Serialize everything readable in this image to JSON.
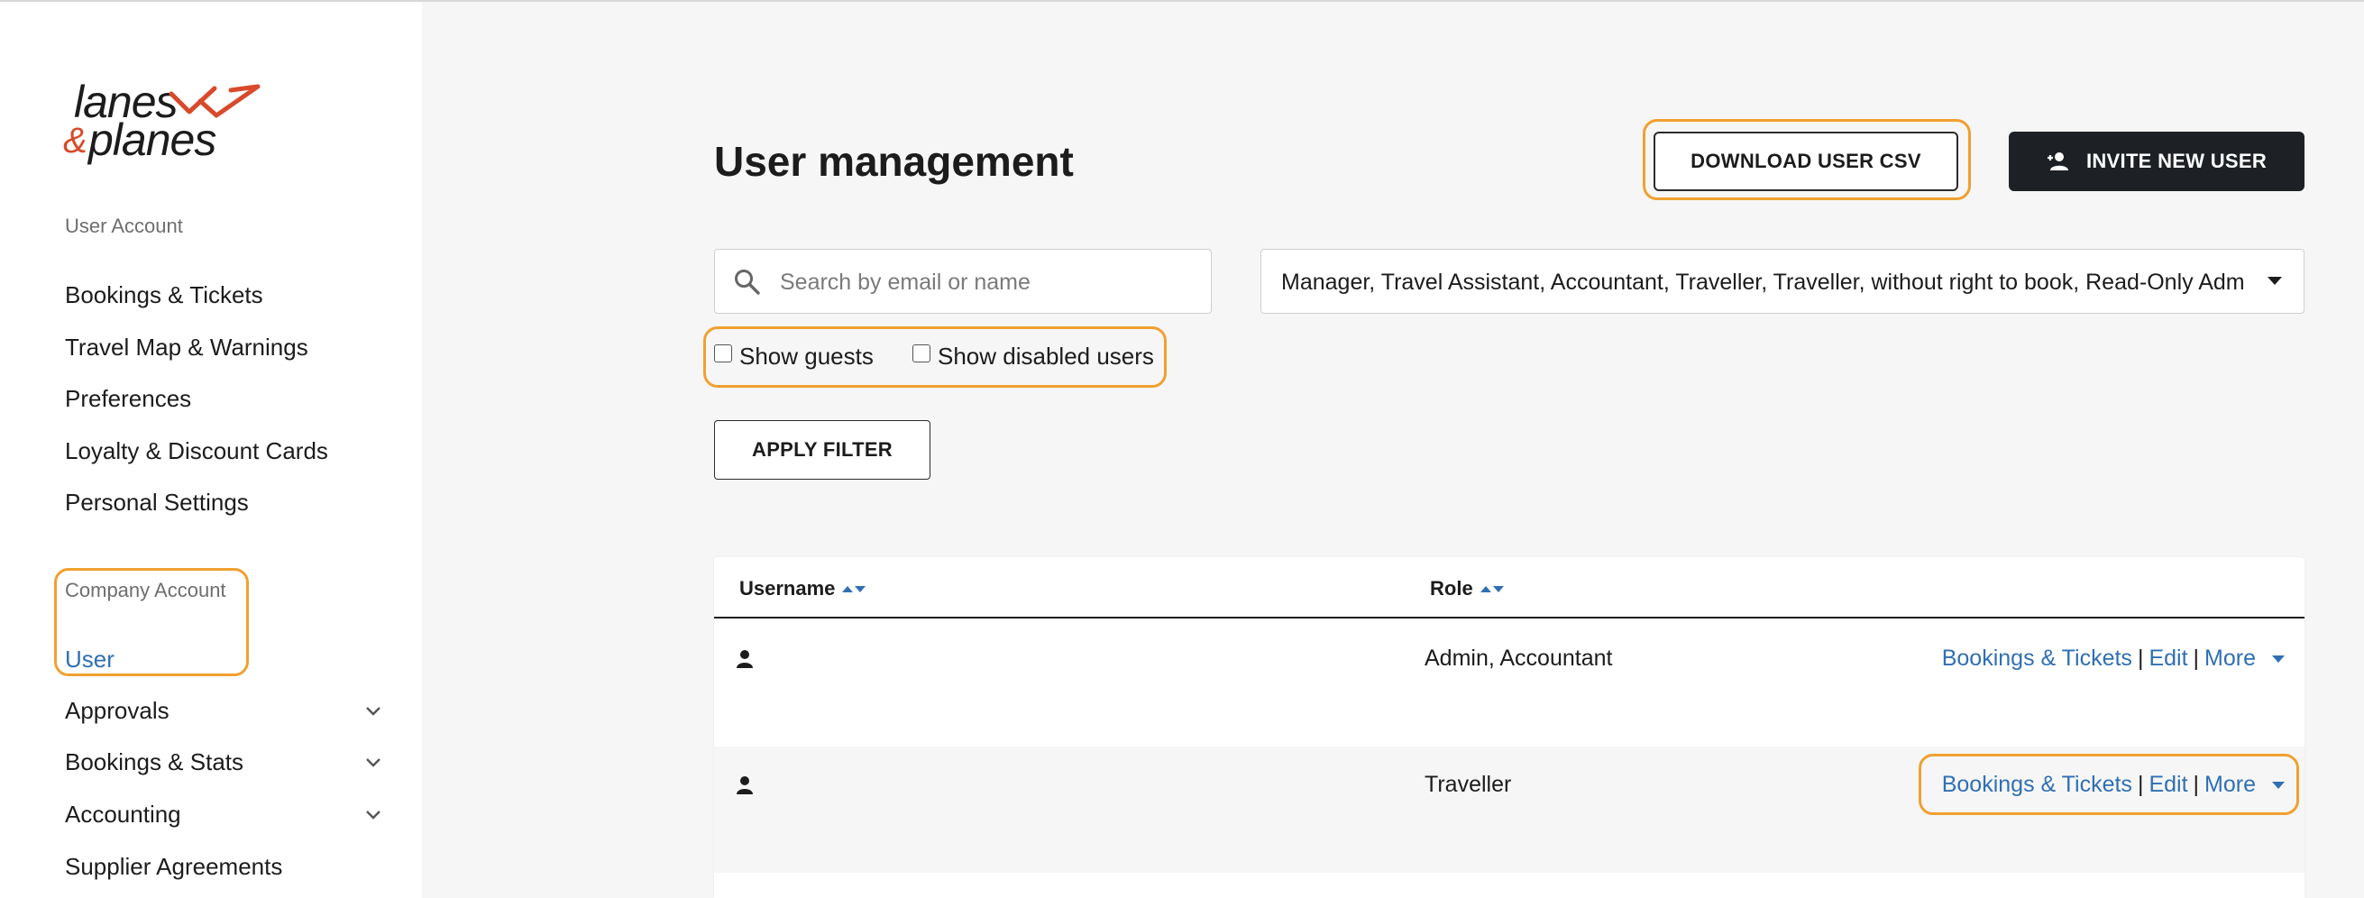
{
  "logo": {
    "word1": "lanes",
    "amp": "&",
    "word2": "planes"
  },
  "sidebar": {
    "user_account_label": "User Account",
    "user_items": [
      {
        "label": "Bookings & Tickets"
      },
      {
        "label": "Travel Map & Warnings"
      },
      {
        "label": "Preferences"
      },
      {
        "label": "Loyalty & Discount Cards"
      },
      {
        "label": "Personal Settings"
      }
    ],
    "company_account_label": "Company Account",
    "company_items": [
      {
        "label": "User",
        "active": true
      },
      {
        "label": "Approvals",
        "expandable": true
      },
      {
        "label": "Bookings & Stats",
        "expandable": true
      },
      {
        "label": "Accounting",
        "expandable": true
      },
      {
        "label": "Supplier Agreements"
      }
    ]
  },
  "main": {
    "title": "User management",
    "download_button": "DOWNLOAD USER CSV",
    "invite_button": "INVITE NEW USER",
    "search": {
      "placeholder": "Search by email or name",
      "value": ""
    },
    "role_filter": {
      "value": "Manager, Travel Assistant, Accountant, Traveller, Traveller, without right to book, Read-Only Admin"
    },
    "show_guests": {
      "label": "Show guests",
      "checked": false
    },
    "show_disabled": {
      "label": "Show disabled users",
      "checked": false
    },
    "apply_filter": "APPLY FILTER"
  },
  "table": {
    "columns": {
      "username": "Username",
      "role": "Role"
    },
    "rows": [
      {
        "username": "",
        "role": "Admin, Accountant",
        "actions": {
          "bookings": "Bookings & Tickets",
          "sep1": "|",
          "edit": "Edit",
          "sep2": "|",
          "more": "More"
        }
      },
      {
        "username": "",
        "role": "Traveller",
        "actions": {
          "bookings": "Bookings & Tickets",
          "sep1": "|",
          "edit": "Edit",
          "sep2": "|",
          "more": "More"
        }
      }
    ]
  },
  "colors": {
    "accent_link": "#2f6fb3",
    "highlight": "#f0a030",
    "dark_button": "#1d2125",
    "logo_red": "#d84a2b"
  }
}
